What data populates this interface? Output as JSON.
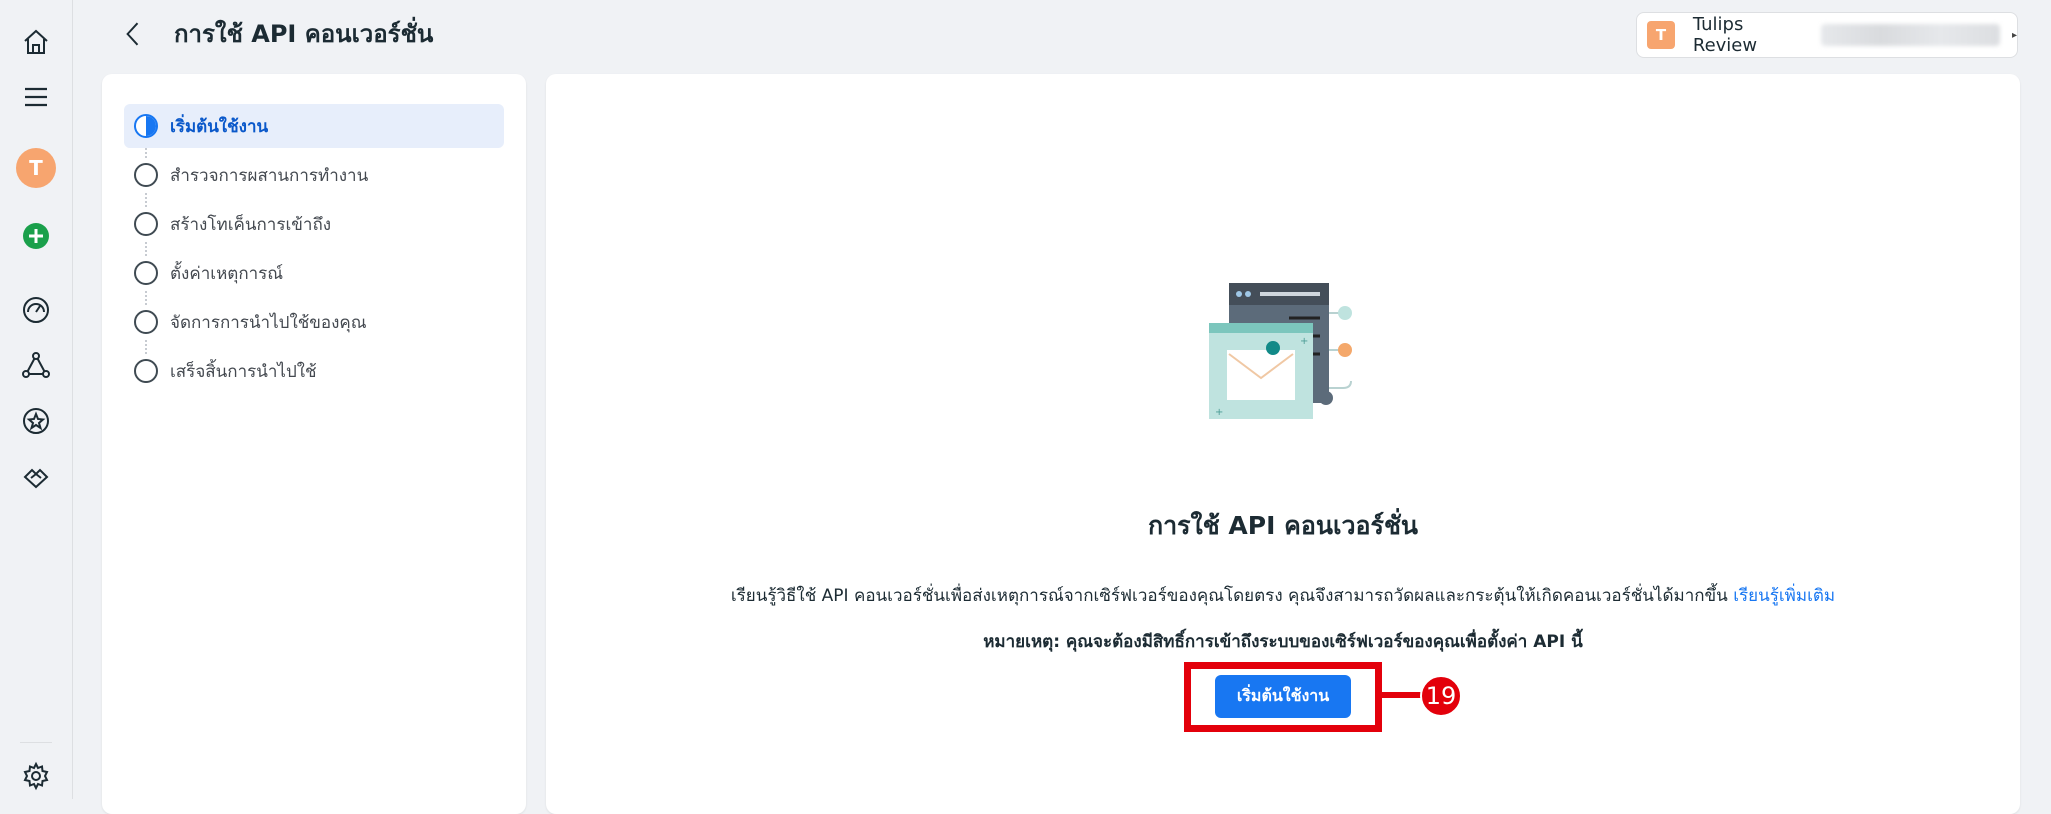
{
  "header": {
    "title": "การใช้ API คอนเวอร์ชั่น",
    "account": {
      "initial": "T",
      "name": "Tulips Review"
    }
  },
  "rail": {
    "avatar_initial": "T",
    "icons": [
      "home-icon",
      "menu-icon",
      "avatar",
      "add-icon",
      "dashboard-icon",
      "network-icon",
      "star-icon",
      "partnership-icon",
      "settings-icon"
    ]
  },
  "steps": [
    {
      "label": "เริ่มต้นใช้งาน",
      "active": true
    },
    {
      "label": "สำรวจการผสานการทำงาน",
      "active": false
    },
    {
      "label": "สร้างโทเค็นการเข้าถึง",
      "active": false
    },
    {
      "label": "ตั้งค่าเหตุการณ์",
      "active": false
    },
    {
      "label": "จัดการการนำไปใช้ของคุณ",
      "active": false
    },
    {
      "label": "เสร็จสิ้นการนำไปใช้",
      "active": false
    }
  ],
  "main": {
    "title": "การใช้ API คอนเวอร์ชั่น",
    "description": "เรียนรู้วิธีใช้ API คอนเวอร์ชั่นเพื่อส่งเหตุการณ์จากเซิร์ฟเวอร์ของคุณโดยตรง คุณจึงสามารถวัดผลและกระตุ้นให้เกิดคอนเวอร์ชั่นได้มากขึ้น",
    "learn_more": "เรียนรู้เพิ่มเติม",
    "note": "หมายเหตุ: คุณจะต้องมีสิทธิ์การเข้าถึงระบบของเซิร์ฟเวอร์ของคุณเพื่อตั้งค่า API นี้",
    "start_button": "เริ่มต้นใช้งาน"
  },
  "annotation": {
    "number": "19"
  },
  "colors": {
    "accent": "#1877f2",
    "highlight": "#e3000b",
    "avatar": "#f7a56f",
    "add": "#1aa04b"
  }
}
